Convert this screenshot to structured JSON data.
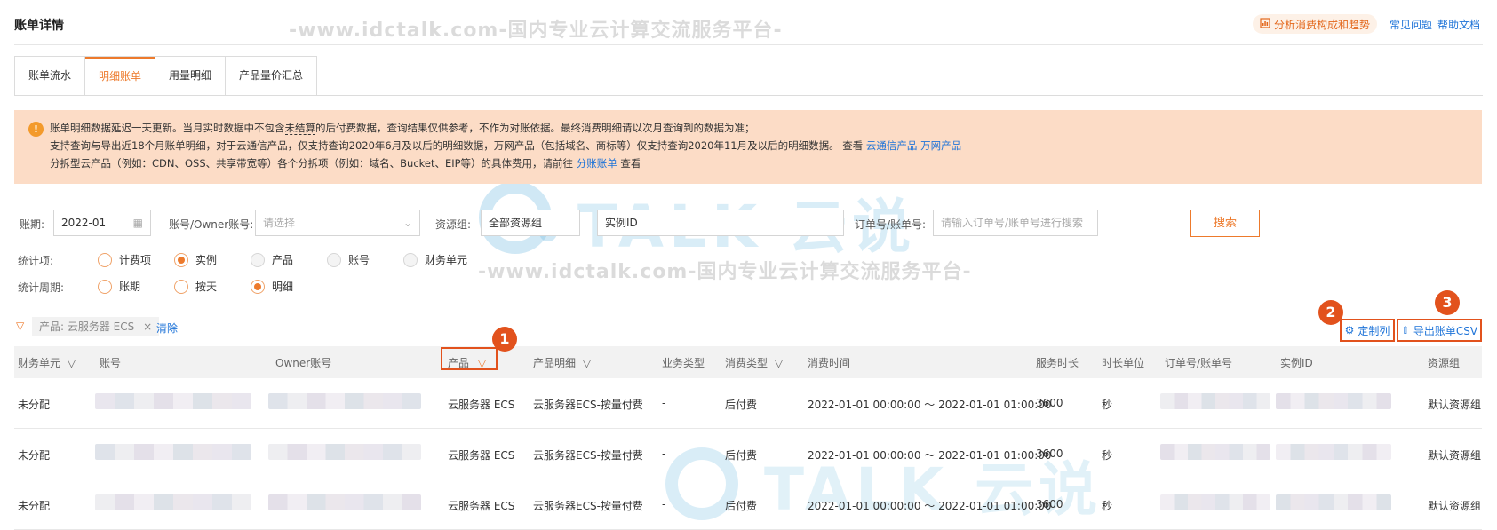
{
  "header": {
    "title": "账单详情",
    "trend_button": "分析消费构成和趋势",
    "faq_link": "常见问题",
    "help_link": "帮助文档"
  },
  "tabs": [
    {
      "label": "账单流水",
      "active": false
    },
    {
      "label": "明细账单",
      "active": true
    },
    {
      "label": "用量明细",
      "active": false
    },
    {
      "label": "产品量价汇总",
      "active": false
    }
  ],
  "notice": {
    "line1_a": "账单明细数据延迟一天更新。当月实时数据中不包含",
    "line1_dashed": "未结算",
    "line1_b": "的后付费数据，查询结果仅供参考，不作为对账依据。最终消费明细请以次月查询到的数据为准；",
    "line2": "支持查询与导出近18个月账单明细，对于云通信产品，仅支持查询2020年6月及以后的明细数据，万网产品（包括域名、商标等）仅支持查询2020年11月及以后的明细数据。 查看",
    "line2_link1": "云通信产品",
    "line2_link2": "万网产品",
    "line3": "分拆型云产品（例如：CDN、OSS、共享带宽等）各个分拆项（例如：域名、Bucket、EIP等）的具体费用，请前往",
    "line3_link": "分账账单",
    "line3_end": "查看"
  },
  "filters": {
    "period_label": "账期:",
    "period_value": "2022-01",
    "account_label": "账号/Owner账号:",
    "account_placeholder": "请选择",
    "resgroup_label": "资源组:",
    "resgroup_value": "全部资源组",
    "instance_select": "实例ID",
    "order_label": "订单号/账单号:",
    "order_placeholder": "请输入订单号/账单号进行搜索",
    "search_button": "搜索"
  },
  "stat_item": {
    "label": "统计项:",
    "options": [
      {
        "label": "计费项",
        "state": "off"
      },
      {
        "label": "实例",
        "state": "on"
      },
      {
        "label": "产品",
        "state": "disabled"
      },
      {
        "label": "账号",
        "state": "disabled"
      },
      {
        "label": "财务单元",
        "state": "disabled"
      }
    ]
  },
  "stat_period": {
    "label": "统计周期:",
    "options": [
      {
        "label": "账期",
        "state": "off"
      },
      {
        "label": "按天",
        "state": "off"
      },
      {
        "label": "明细",
        "state": "on"
      }
    ]
  },
  "active_filter": {
    "tag": "产品: 云服务器 ECS",
    "clear": "清除"
  },
  "toolbar": {
    "custom_columns": "定制列",
    "export_csv": "导出账单CSV"
  },
  "callouts": [
    "1",
    "2",
    "3"
  ],
  "table": {
    "headers": [
      "财务单元",
      "账号",
      "Owner账号",
      "产品",
      "产品明细",
      "业务类型",
      "消费类型",
      "消费时间",
      "服务时长",
      "时长单位",
      "订单号/账单号",
      "实例ID",
      "资源组"
    ],
    "rows": [
      {
        "unit": "未分配",
        "product": "云服务器 ECS",
        "detail": "云服务器ECS-按量付费",
        "biz": "-",
        "type": "后付费",
        "time": "2022-01-01 00:00:00 ～ 2022-01-01 01:00:00",
        "duration": "3600",
        "unit_time": "秒",
        "group": "默认资源组"
      },
      {
        "unit": "未分配",
        "product": "云服务器 ECS",
        "detail": "云服务器ECS-按量付费",
        "biz": "-",
        "type": "后付费",
        "time": "2022-01-01 00:00:00 ～ 2022-01-01 01:00:00",
        "duration": "3600",
        "unit_time": "秒",
        "group": "默认资源组"
      },
      {
        "unit": "未分配",
        "product": "云服务器 ECS",
        "detail": "云服务器ECS-按量付费",
        "biz": "-",
        "type": "后付费",
        "time": "2022-01-01 00:00:00 ～ 2022-01-01 01:00:00",
        "duration": "3600",
        "unit_time": "秒",
        "group": "默认资源组"
      }
    ]
  },
  "watermark": {
    "text": "-www.idctalk.com-国内专业云计算交流服务平台-",
    "logo": "TALK 云说"
  },
  "colors": {
    "accent": "#ed7a2c",
    "link": "#1f74d8",
    "callout": "#e2521d",
    "notice_bg": "#fcdcc6"
  }
}
